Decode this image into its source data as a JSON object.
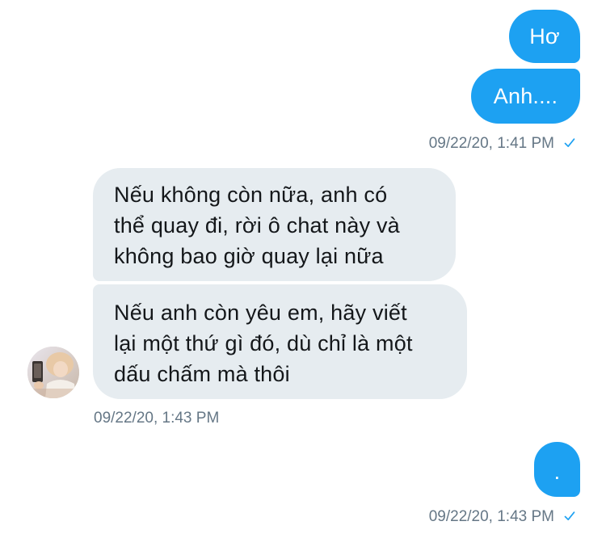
{
  "conversation": {
    "sent_group_1": {
      "messages": [
        "Hơ",
        "Anh...."
      ],
      "timestamp": "09/22/20, 1:41 PM",
      "status_icon": "check-icon",
      "bubble_color": "#1da1f2"
    },
    "received_group": {
      "messages": [
        "Nếu không còn nữa, anh có\nthể quay đi, rời ô chat này và\nkhông bao giờ quay lại nữa",
        "Nếu anh còn yêu em, hãy viết\nlại một thứ gì đó, dù chỉ là một\ndấu chấm mà thôi"
      ],
      "timestamp": "09/22/20, 1:43 PM",
      "avatar_icon": "avatar-photo",
      "bubble_color": "#e6ecf0"
    },
    "sent_group_2": {
      "messages": [
        "."
      ],
      "timestamp": "09/22/20, 1:43 PM",
      "status_icon": "check-icon"
    }
  },
  "colors": {
    "accent": "#1da1f2",
    "meta_text": "#657786",
    "received_text": "#14171a"
  }
}
